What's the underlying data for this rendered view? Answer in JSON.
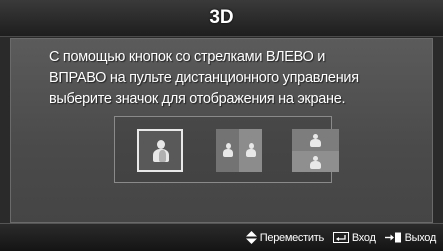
{
  "window": {
    "title": "3D"
  },
  "message": {
    "text": "С помощью кнопок со стрелками ВЛЕВО и\nВПРАВО на пульте дистанционного управления\nвыберите значок для отображения на экране."
  },
  "mode_options": [
    {
      "icon": "single-person-2d-icon",
      "selected": true
    },
    {
      "icon": "side-by-side-icon",
      "selected": false
    },
    {
      "icon": "top-bottom-icon",
      "selected": false
    }
  ],
  "footer": {
    "move_label": "Переместить",
    "enter_label": "Вход",
    "exit_label": "Выход"
  },
  "colors": {
    "panel": "#4f4f4f",
    "selection_border": "#e9e9e9",
    "text": "#ffffff"
  }
}
